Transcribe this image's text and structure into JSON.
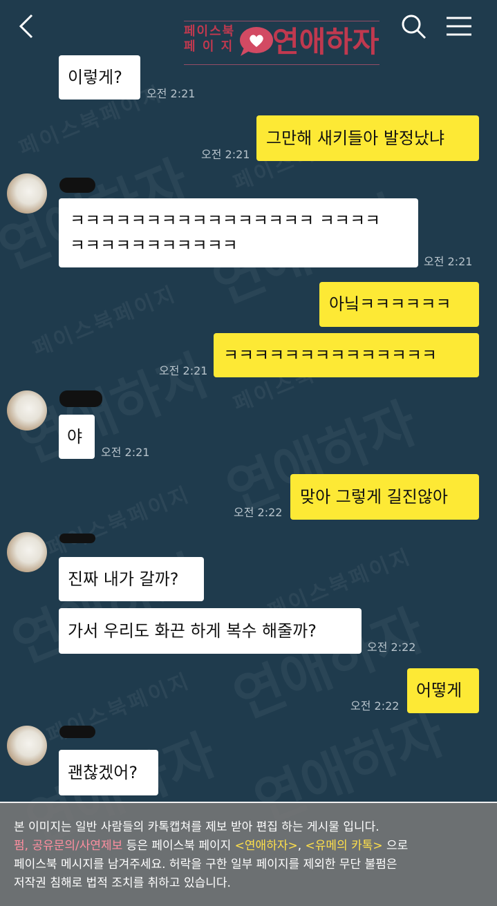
{
  "header": {
    "logo_small_line1": "페이스북",
    "logo_small_line2": "페 이 지",
    "logo_big": "연애하자"
  },
  "watermark": {
    "main": "연애하자",
    "small": "페이스북페이지"
  },
  "messages": [
    {
      "text": "이렇게?",
      "time": "오전 2:21"
    },
    {
      "text": "그만해 새키들아 발정났냐",
      "time": "오전 2:21"
    },
    {
      "line1": "ㅋㅋㅋㅋㅋㅋㅋㅋㅋㅋㅋㅋㅋㅋㅋㅋ ㅋㅋㅋㅋ",
      "line2": "ㅋㅋㅋㅋㅋㅋㅋㅋㅋㅋㅋ",
      "time": "오전 2:21"
    },
    {
      "text": "아닠ㅋㅋㅋㅋㅋㅋ"
    },
    {
      "text": "ㅋㅋㅋㅋㅋㅋㅋㅋㅋㅋㅋㅋㅋㅋ",
      "time": "오전 2:21"
    },
    {
      "text": "야",
      "time": "오전 2:21"
    },
    {
      "text": "맞아 그렇게 길진않아",
      "time": "오전 2:22"
    },
    {
      "text": "진짜 내가 갈까?"
    },
    {
      "text": "가서 우리도 화끈 하게 복수 해줄까?",
      "time": "오전 2:22"
    },
    {
      "text": "어떻게",
      "time": "오전 2:22"
    },
    {
      "text": "괜찮겠어?"
    }
  ],
  "notice": {
    "line1": "본 이미지는 일반 사람들의 카톡캡쳐를 제보 받아 편집 하는 게시물 입니다.",
    "line2_red": "펌, 공유문의/사연제보",
    "line2_a": " 등은 페이스북 페이지 ",
    "line2_y1": "<연애하자>",
    "line2_b": ", ",
    "line2_y2": "<유메의 카톡>",
    "line2_c": " 으로",
    "line3": "페이스북 메시지를 남겨주세요. 허락을 구한 일부 페이지를 제외한 무단 불펌은",
    "line4": "저작권 침해로 법적 조치를 취하고 있습니다."
  },
  "colors": {
    "background": "#1f3b4d",
    "incoming_bubble": "#ffffff",
    "outgoing_bubble": "#fde935",
    "logo": "#c0394f"
  },
  "icons": [
    "back-arrow-icon",
    "search-icon",
    "menu-icon",
    "heart-icon"
  ]
}
